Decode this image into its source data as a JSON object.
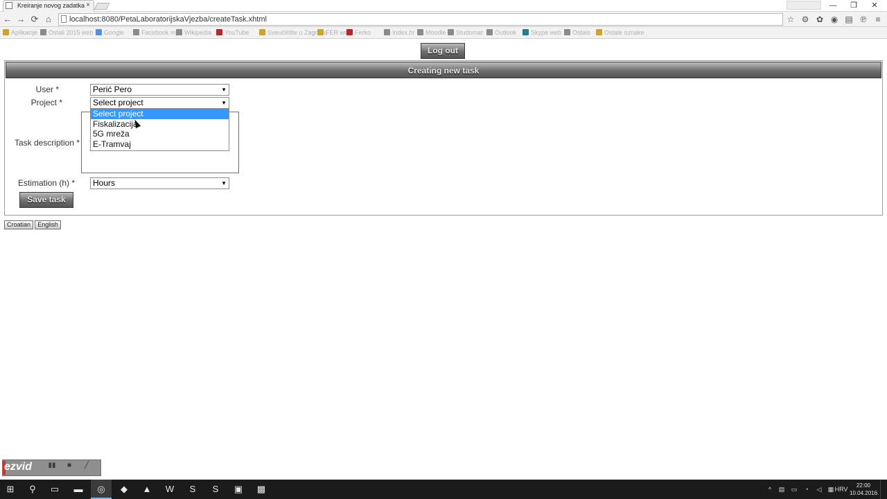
{
  "browser": {
    "tab_title": "Kreiranje novog zadatka",
    "tab_close": "×",
    "url": "localhost:8080/PetaLaboratorijskaVjezba/createTask.xhtml",
    "back_icon": "←",
    "forward_icon": "→",
    "reload_icon": "⟳",
    "home_icon": "⌂",
    "star_icon": "☆",
    "min_icon": "—",
    "max_icon": "❐",
    "close_icon": "✕",
    "extensions": [
      "⚙",
      "✿",
      "◉",
      "▤",
      "℗",
      "≡"
    ],
    "bookmarks": [
      {
        "label": "Aplikacije",
        "color": "#c9a23a"
      },
      {
        "label": "Ostali 2015 web",
        "color": "#8a8a8a"
      },
      {
        "label": "Google",
        "color": "#5a8de0"
      },
      {
        "label": "Facebook mj",
        "color": "#8a8a8a"
      },
      {
        "label": "Wikipedia",
        "color": "#8a8a8a"
      },
      {
        "label": "YouTube",
        "color": "#b02a2a"
      },
      {
        "label": "Sveučilište u Zagrebu",
        "color": "#c9a23a"
      },
      {
        "label": "FER web",
        "color": "#c9a23a"
      },
      {
        "label": "Ferko",
        "color": "#b02a2a"
      },
      {
        "label": "Index.hr",
        "color": "#8a8a8a"
      },
      {
        "label": "Moodle",
        "color": "#8a8a8a"
      },
      {
        "label": "Studomat",
        "color": "#8a8a8a"
      },
      {
        "label": "Outlook",
        "color": "#8a8a8a"
      },
      {
        "label": "Skype web",
        "color": "#2b7a8a"
      },
      {
        "label": "Ostalo",
        "color": "#8a8a8a"
      },
      {
        "label": "Ostale oznake",
        "color": "#c9a23a"
      }
    ]
  },
  "page": {
    "logout_label": "Log out",
    "panel_title": "Creating new task",
    "fields": {
      "user_label": "User *",
      "user_value": "Perić Pero",
      "project_label": "Project *",
      "project_value": "Select project",
      "description_label": "Task description *",
      "estimation_label": "Estimation (h) *",
      "estimation_value": "Hours"
    },
    "project_options": [
      "Select project",
      "Fiskalizacija",
      "5G mreža",
      "E-Tramvaj"
    ],
    "save_label": "Save task",
    "lang_croatian": "Croatian",
    "lang_english": "English",
    "select_arrow": "▼"
  },
  "recorder": {
    "logo": "ezvid",
    "buttons": [
      "▮▮",
      "■",
      "╱"
    ]
  },
  "taskbar": {
    "start_icon": "⊞",
    "search_icon": "⚲",
    "taskview_icon": "▭",
    "apps": [
      "▬",
      "◎",
      "◆",
      "▲",
      "W",
      "S",
      "S",
      "▣",
      "▩"
    ],
    "language": "HRV",
    "time": "22:00",
    "date": "10.04.2016."
  },
  "colors": {
    "selected_option": "#3399ff",
    "taskbar": "#1b1b1b"
  }
}
